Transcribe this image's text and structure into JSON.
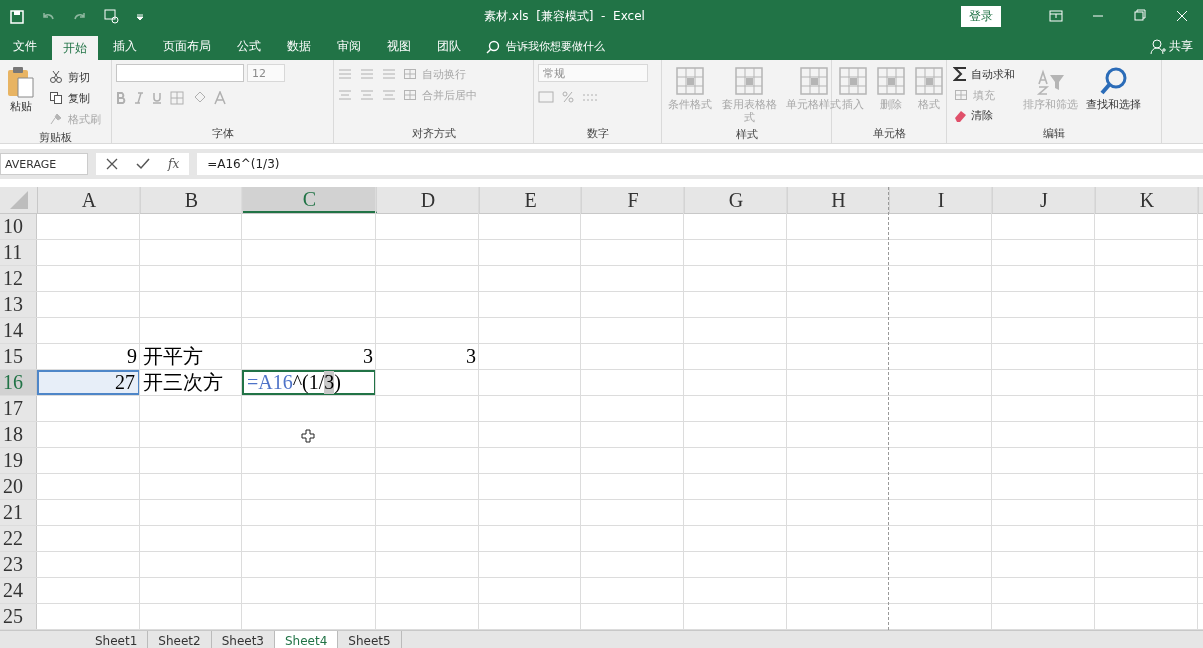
{
  "title_bar": {
    "title": "素材.xls  [兼容模式]  -  Excel",
    "login": "登录"
  },
  "menu_tabs": [
    {
      "label": "文件",
      "selected": false
    },
    {
      "label": "开始",
      "selected": true
    },
    {
      "label": "插入",
      "selected": false
    },
    {
      "label": "页面布局",
      "selected": false
    },
    {
      "label": "公式",
      "selected": false
    },
    {
      "label": "数据",
      "selected": false
    },
    {
      "label": "审阅",
      "selected": false
    },
    {
      "label": "视图",
      "selected": false
    },
    {
      "label": "团队",
      "selected": false
    }
  ],
  "tell_me": "告诉我你想要做什么",
  "share": "共享",
  "ribbon": [
    {
      "label": "剪贴板",
      "items": [
        {
          "kind": "large",
          "label": "粘贴",
          "disabled": false
        },
        {
          "kind": "small",
          "label": "剪切",
          "disabled": false
        },
        {
          "kind": "small",
          "label": "复制",
          "disabled": false
        },
        {
          "kind": "small",
          "label": "格式刷",
          "disabled": true
        }
      ]
    },
    {
      "label": "字体",
      "items": [
        {
          "kind": "field",
          "value": "12",
          "disabled": true
        }
      ]
    },
    {
      "label": "对齐方式",
      "items": [
        {
          "kind": "small",
          "label": "自动换行",
          "disabled": true
        },
        {
          "kind": "small",
          "label": "合并后居中",
          "disabled": true
        }
      ]
    },
    {
      "label": "数字",
      "items": [
        {
          "kind": "field",
          "value": "常规",
          "disabled": true
        }
      ]
    },
    {
      "label": "样式",
      "items": [
        {
          "kind": "large",
          "label": "条件格式",
          "disabled": true
        },
        {
          "kind": "large",
          "label": "套用表格格式",
          "disabled": true
        },
        {
          "kind": "large",
          "label": "单元格样式",
          "disabled": true
        }
      ]
    },
    {
      "label": "单元格",
      "items": [
        {
          "kind": "large",
          "label": "插入",
          "disabled": true
        },
        {
          "kind": "large",
          "label": "删除",
          "disabled": true
        },
        {
          "kind": "large",
          "label": "格式",
          "disabled": true
        }
      ]
    },
    {
      "label": "编辑",
      "items": [
        {
          "kind": "small",
          "label": "自动求和",
          "disabled": false
        },
        {
          "kind": "small",
          "label": "填充",
          "disabled": true
        },
        {
          "kind": "small",
          "label": "清除",
          "disabled": false
        },
        {
          "kind": "large",
          "label": "排序和筛选",
          "disabled": true
        },
        {
          "kind": "large",
          "label": "查找和选择",
          "disabled": false
        }
      ]
    }
  ],
  "formula_bar": {
    "name_box": "AVERAGE",
    "fx": "fx",
    "formula": "=A16^(1/3)"
  },
  "columns": [
    {
      "label": "A",
      "selected": false
    },
    {
      "label": "B",
      "selected": false
    },
    {
      "label": "C",
      "selected": true
    },
    {
      "label": "D",
      "selected": false
    },
    {
      "label": "E",
      "selected": false
    },
    {
      "label": "F",
      "selected": false
    },
    {
      "label": "G",
      "selected": false
    },
    {
      "label": "H",
      "selected": false
    },
    {
      "label": "I",
      "selected": false
    },
    {
      "label": "J",
      "selected": false
    },
    {
      "label": "K",
      "selected": false
    }
  ],
  "rows": [
    {
      "number": "10",
      "selected": false
    },
    {
      "number": "11",
      "selected": false
    },
    {
      "number": "12",
      "selected": false
    },
    {
      "number": "13",
      "selected": false
    },
    {
      "number": "14",
      "selected": false
    },
    {
      "number": "15",
      "selected": false,
      "cells": [
        {
          "kind": "number",
          "value": "9",
          "selected": false
        },
        {
          "kind": "text",
          "value": "开平方",
          "selected": false
        },
        {
          "kind": "number",
          "value": "3",
          "selected": false
        },
        {
          "kind": "number",
          "value": "3",
          "selected": false
        }
      ]
    },
    {
      "number": "16",
      "selected": true,
      "cells": [
        {
          "kind": "number",
          "value": "27",
          "selected": true
        },
        {
          "kind": "text",
          "value": "开三次方",
          "selected": false
        },
        {
          "kind": "editing",
          "selected": false,
          "parts": [
            {
              "text": "=A16",
              "kind": "reference"
            },
            {
              "text": "^(1/",
              "kind": "plain"
            },
            {
              "text": "3",
              "kind": "highlight"
            },
            {
              "text": ")",
              "kind": "plain"
            }
          ]
        }
      ]
    },
    {
      "number": "17",
      "selected": false
    },
    {
      "number": "18",
      "selected": false
    },
    {
      "number": "19",
      "selected": false
    },
    {
      "number": "20",
      "selected": false
    },
    {
      "number": "21",
      "selected": false
    },
    {
      "number": "22",
      "selected": false
    },
    {
      "number": "23",
      "selected": false
    },
    {
      "number": "24",
      "selected": false
    },
    {
      "number": "25",
      "selected": false
    }
  ],
  "sheets": [
    {
      "label": "Sheet1",
      "selected": false
    },
    {
      "label": "Sheet2",
      "selected": false
    },
    {
      "label": "Sheet3",
      "selected": false
    },
    {
      "label": "Sheet4",
      "selected": true
    },
    {
      "label": "Sheet5",
      "selected": false
    }
  ]
}
